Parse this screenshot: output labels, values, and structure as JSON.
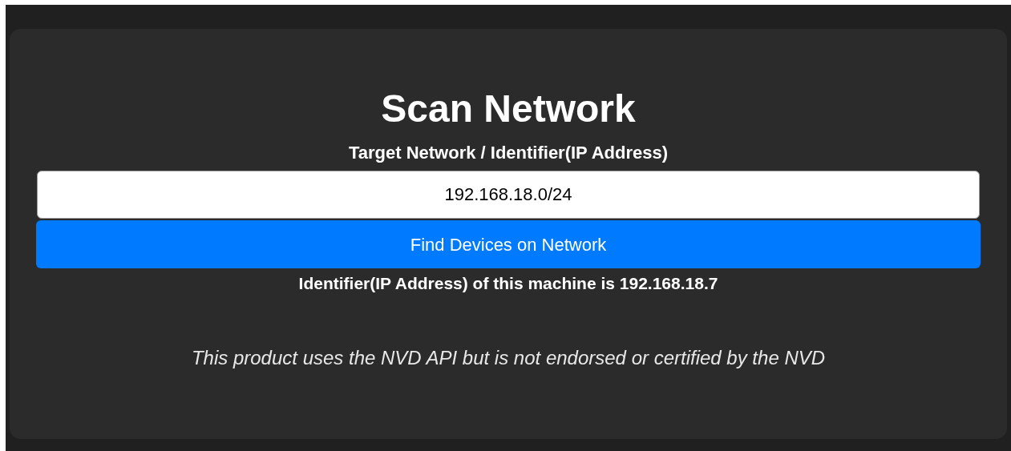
{
  "title": "Scan Network",
  "field": {
    "label": "Target Network / Identifier(IP Address)",
    "value": "192.168.18.0/24"
  },
  "button": {
    "label": "Find Devices on Network"
  },
  "machine_info": "Identifier(IP Address) of this machine is 192.168.18.7",
  "disclaimer": "This product uses the NVD API but is not endorsed or certified by the NVD"
}
